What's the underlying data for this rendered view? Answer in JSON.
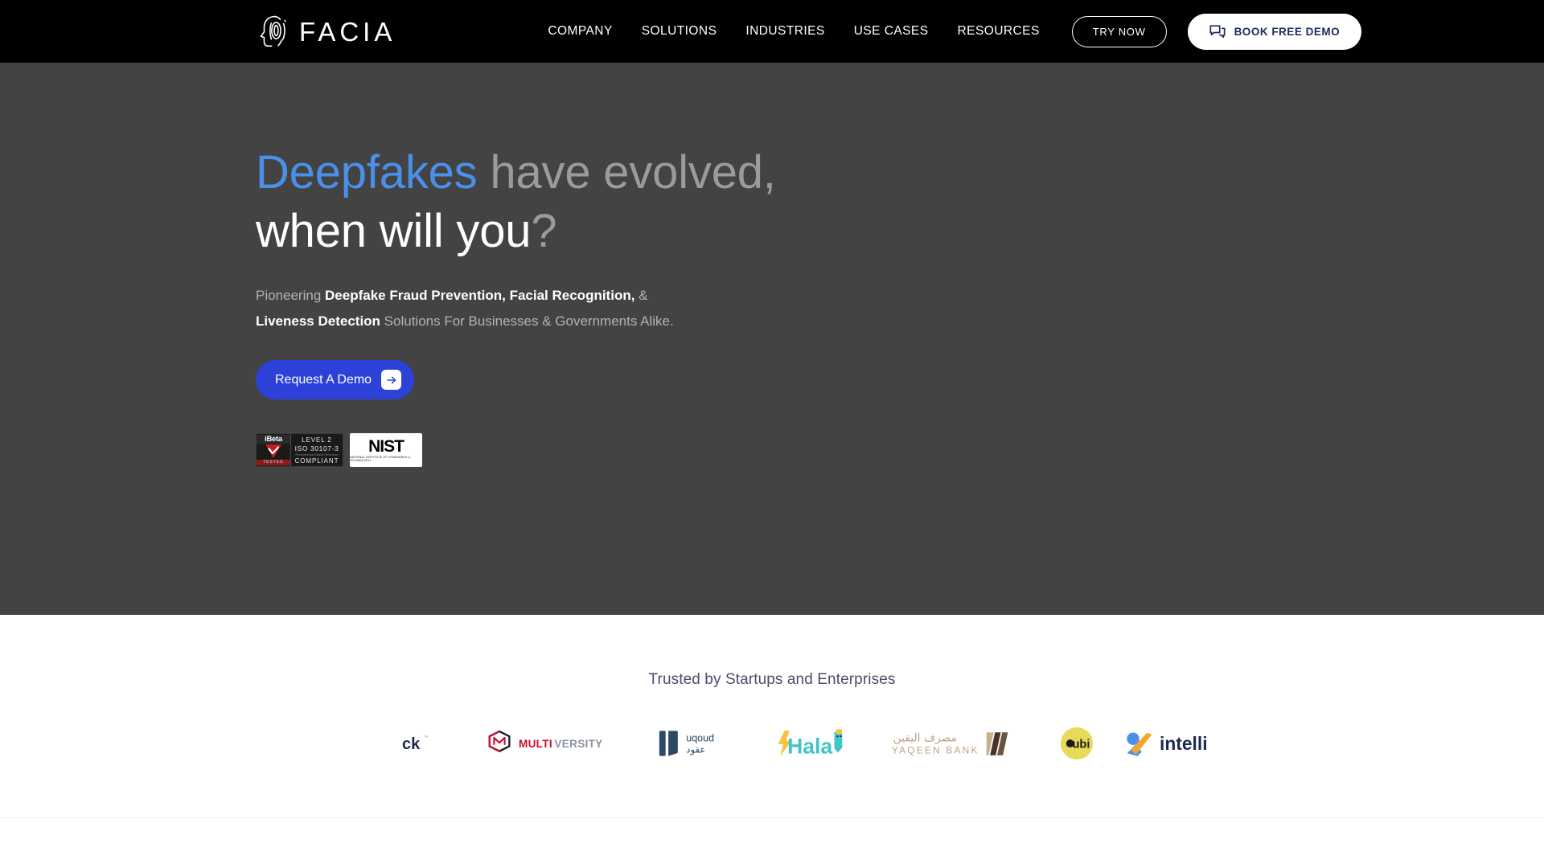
{
  "header": {
    "logo": {
      "icon": "facia-fingerprint-face-icon",
      "text": "FACIA"
    },
    "nav": [
      {
        "label": "COMPANY"
      },
      {
        "label": "SOLUTIONS"
      },
      {
        "label": "INDUSTRIES"
      },
      {
        "label": "USE CASES"
      },
      {
        "label": "RESOURCES"
      }
    ],
    "try_now_label": "TRY NOW",
    "book_demo_label": "BOOK FREE DEMO",
    "book_demo_icon": "chat-bubbles-icon"
  },
  "hero": {
    "headline": {
      "part1": "Deepfakes ",
      "part2": "have evolved, ",
      "part3": "when will you",
      "part4": "?"
    },
    "subhead": {
      "t1": "Pioneering ",
      "b1": "Deepfake Fraud Prevention, Facial Recognition,",
      "t2": " & ",
      "b2": "Liveness Detection",
      "t3": " Solutions For Businesses & Governments Alike."
    },
    "cta_label": "Request A Demo",
    "cta_icon": "arrow-right-icon",
    "badges": {
      "ibeta": {
        "logo": "iBeta",
        "tested": "TESTED",
        "line1": "LEVEL 2",
        "line2": "ISO 30107-3",
        "line3": "Presentation Attack Detection",
        "line4": "COMPLIANT"
      },
      "nist": {
        "word": "NIST",
        "subtitle": "NATIONAL INSTITUTE OF STANDARDS & TECHNOLOGY"
      }
    }
  },
  "trusted": {
    "title": "Trusted by Startups and Enterprises",
    "logos": [
      {
        "name": "ck",
        "label": "ck"
      },
      {
        "name": "multiversity",
        "label": "MULTIVERSITY"
      },
      {
        "name": "uqoud",
        "label": "uqoud",
        "label_ar": "عقود"
      },
      {
        "name": "hala",
        "label": "Hala"
      },
      {
        "name": "yaqeen-bank",
        "label": "YAQEEN BANK",
        "label_ar": "مصرف اليقين"
      },
      {
        "name": "dubi",
        "label": "Dubi"
      },
      {
        "name": "intelli",
        "label": "intelli"
      }
    ]
  },
  "colors": {
    "header_bg": "#000000",
    "hero_bg": "#434343",
    "accent_blue": "#4a90e8",
    "cta_blue": "#2b41d8",
    "muted_gray": "#9b9b9b",
    "trusted_title": "#4a4e69"
  }
}
